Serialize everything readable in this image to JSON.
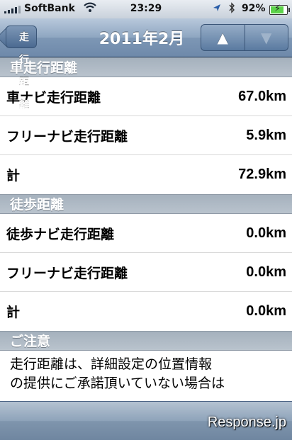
{
  "status_bar": {
    "carrier": "SoftBank",
    "time": "23:29",
    "battery_percent": "92%",
    "battery_level": 0.92,
    "signal_bars": 4,
    "icons": [
      "wifi-icon",
      "location-icon",
      "bluetooth-icon",
      "battery-charging-icon"
    ]
  },
  "navbar": {
    "back_label": "走行距離",
    "title": "2011年2月",
    "prev_label": "▲",
    "next_label": "▼"
  },
  "sections": {
    "car": {
      "header": "車走行距離",
      "rows": [
        {
          "label": "車ナビ走行距離",
          "value": "67.0km"
        },
        {
          "label": "フリーナビ走行距離",
          "value": "5.9km"
        },
        {
          "label": "計",
          "value": "72.9km"
        }
      ]
    },
    "walk": {
      "header": "徒歩距離",
      "rows": [
        {
          "label": "徒歩ナビ走行距離",
          "value": "0.0km"
        },
        {
          "label": "フリーナビ走行距離",
          "value": "0.0km"
        },
        {
          "label": "計",
          "value": "0.0km"
        }
      ]
    },
    "note": {
      "header": "ご注意",
      "line1": "走行距離は、詳細設定の位置情報",
      "line2": "の提供にご承諾頂いていない場合は"
    }
  },
  "watermark": "Response.jp",
  "colors": {
    "nav_bar": "#7d97b5",
    "section_header": "#aab5c1",
    "battery_fill": "#5dd34a"
  }
}
